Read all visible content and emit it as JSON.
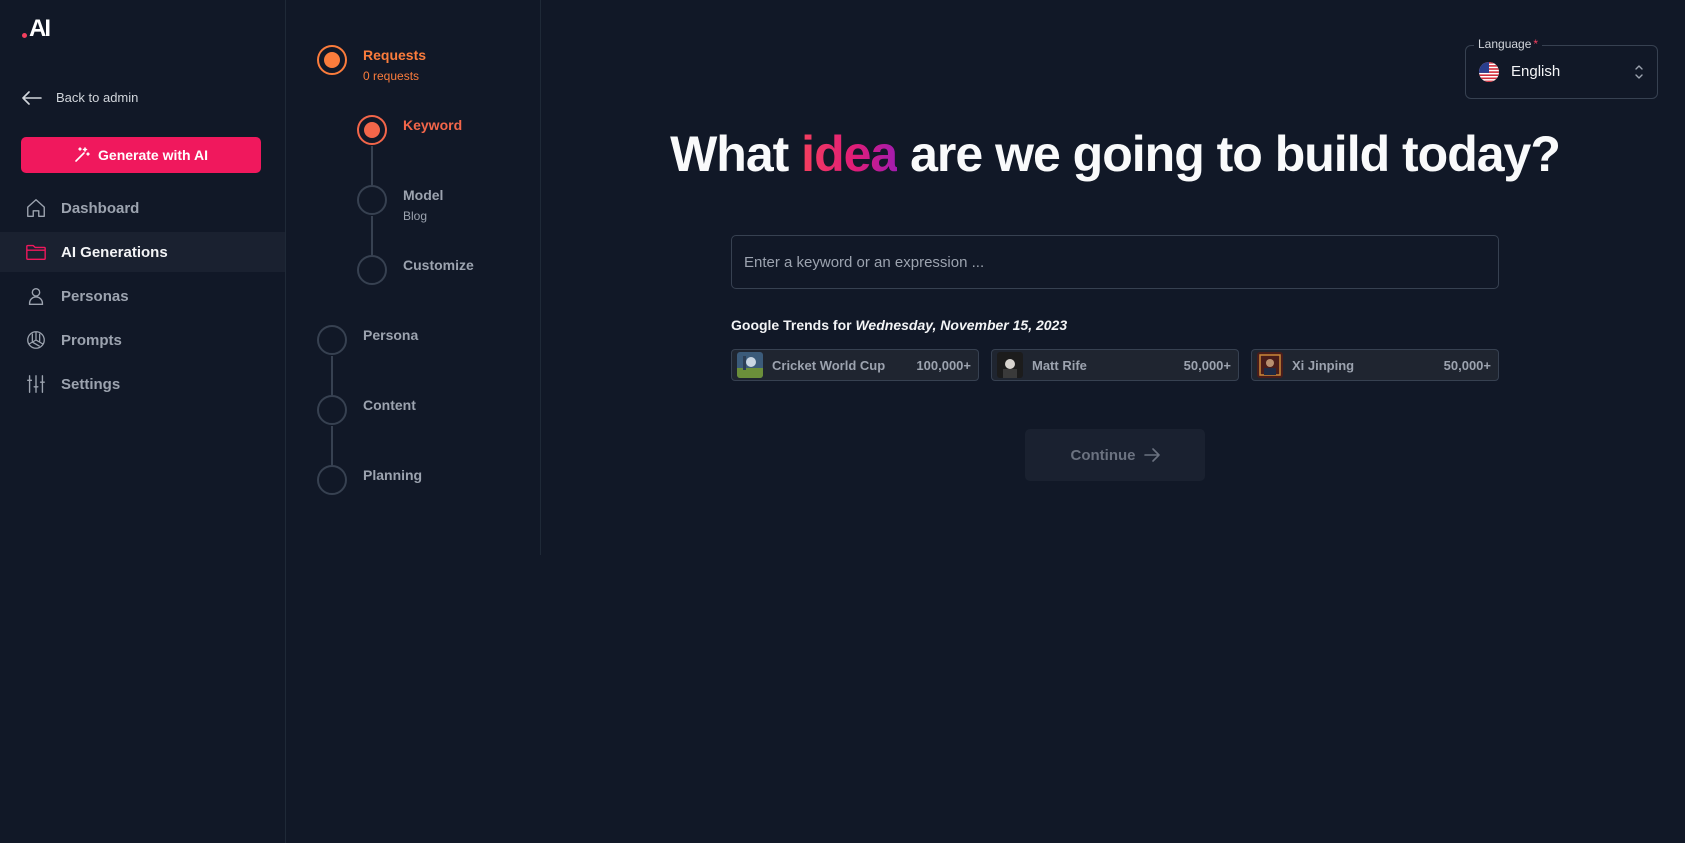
{
  "sidebar": {
    "back_label": "Back to admin",
    "generate_label": "Generate with AI",
    "items": [
      {
        "label": "Dashboard",
        "icon": "home-icon"
      },
      {
        "label": "AI Generations",
        "icon": "folder-icon",
        "active": true
      },
      {
        "label": "Personas",
        "icon": "user-icon"
      },
      {
        "label": "Prompts",
        "icon": "openai-icon"
      },
      {
        "label": "Settings",
        "icon": "sliders-icon"
      }
    ]
  },
  "stepper": {
    "steps": [
      {
        "label": "Requests",
        "sub": "0 requests",
        "state": "active"
      },
      {
        "label": "Keyword",
        "state": "current"
      },
      {
        "label": "Model",
        "sub": "Blog"
      },
      {
        "label": "Customize"
      },
      {
        "label": "Persona"
      },
      {
        "label": "Content"
      },
      {
        "label": "Planning"
      }
    ]
  },
  "language": {
    "label": "Language",
    "required_mark": "*",
    "value": "English",
    "flag_icon": "us-flag-icon"
  },
  "headline": {
    "before": "What ",
    "accent": "idea",
    "after": " are we going to build today?"
  },
  "keyword_input": {
    "placeholder": "Enter a keyword or an expression ...",
    "value": ""
  },
  "trends": {
    "title": "Google Trends for ",
    "date": "Wednesday, November 15, 2023",
    "items": [
      {
        "name": "Cricket World Cup",
        "count": "100,000+"
      },
      {
        "name": "Matt Rife",
        "count": "50,000+"
      },
      {
        "name": "Xi Jinping",
        "count": "50,000+"
      }
    ]
  },
  "continue_label": "Continue",
  "colors": {
    "background": "#111827",
    "brand_pink": "#f0185d",
    "step_orange": "#fb7c3c",
    "step_red": "#f3664a"
  }
}
